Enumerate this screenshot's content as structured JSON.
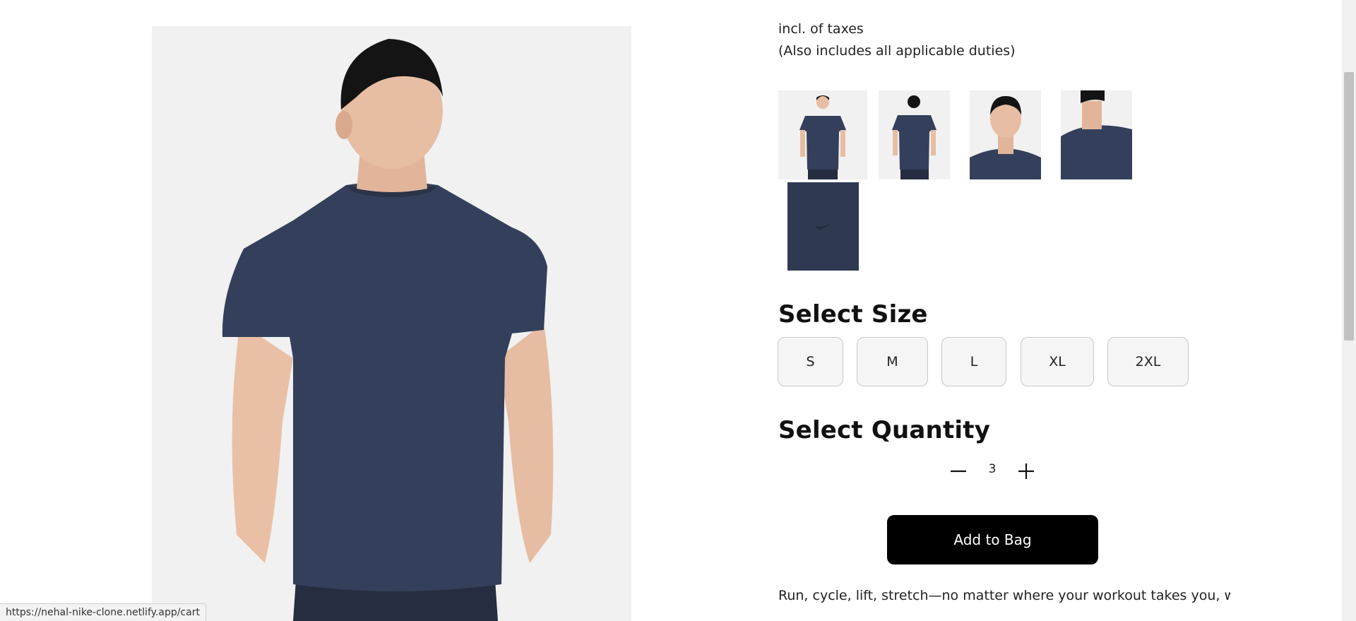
{
  "pricing": {
    "tax_note": "incl. of taxes",
    "duties_note": "(Also includes all applicable duties)"
  },
  "product": {
    "main_image": "tshirt-back-view-image",
    "thumbnails": [
      {
        "name": "thumbnail-front-full"
      },
      {
        "name": "thumbnail-back-full"
      },
      {
        "name": "thumbnail-front-closeup"
      },
      {
        "name": "thumbnail-side-closeup"
      },
      {
        "name": "thumbnail-fabric-logo"
      }
    ],
    "color": "#2f3a52"
  },
  "size_section": {
    "title": "Select Size",
    "sizes": [
      "S",
      "M",
      "L",
      "XL",
      "2XL"
    ]
  },
  "quantity_section": {
    "title": "Select Quantity",
    "value": "3",
    "decrement_icon": "minus-icon",
    "increment_icon": "plus-icon"
  },
  "cart": {
    "add_label": "Add to Bag"
  },
  "description": {
    "text": "Run, cycle, lift, stretch—no matter where your workout takes you, we"
  },
  "status_bar": {
    "url": "https://nehal-nike-clone.netlify.app/cart"
  }
}
